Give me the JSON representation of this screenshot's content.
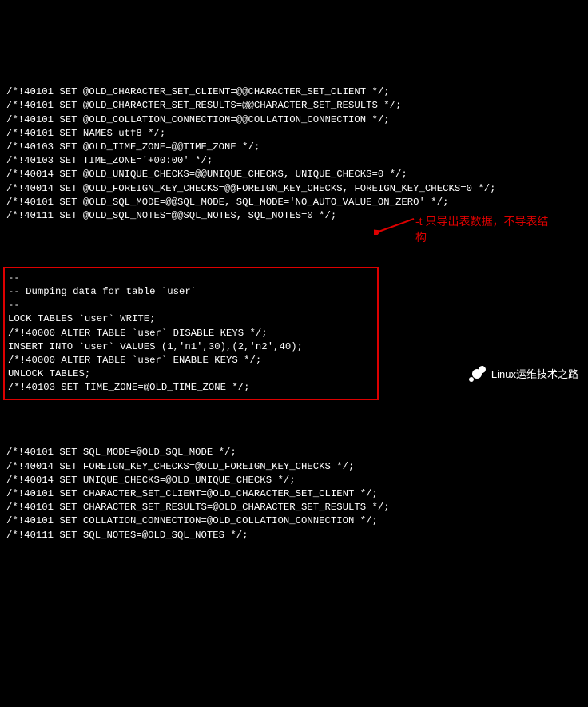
{
  "header_lines": [
    "/*!40101 SET @OLD_CHARACTER_SET_CLIENT=@@CHARACTER_SET_CLIENT */;",
    "/*!40101 SET @OLD_CHARACTER_SET_RESULTS=@@CHARACTER_SET_RESULTS */;",
    "/*!40101 SET @OLD_COLLATION_CONNECTION=@@COLLATION_CONNECTION */;",
    "/*!40101 SET NAMES utf8 */;",
    "/*!40103 SET @OLD_TIME_ZONE=@@TIME_ZONE */;",
    "/*!40103 SET TIME_ZONE='+00:00' */;",
    "/*!40014 SET @OLD_UNIQUE_CHECKS=@@UNIQUE_CHECKS, UNIQUE_CHECKS=0 */;",
    "/*!40014 SET @OLD_FOREIGN_KEY_CHECKS=@@FOREIGN_KEY_CHECKS, FOREIGN_KEY_CHECKS=0 */;",
    "/*!40101 SET @OLD_SQL_MODE=@@SQL_MODE, SQL_MODE='NO_AUTO_VALUE_ON_ZERO' */;",
    "/*!40111 SET @OLD_SQL_NOTES=@@SQL_NOTES, SQL_NOTES=0 */;"
  ],
  "boxed_block": [
    "--",
    "-- Dumping data for table `user`",
    "--",
    "",
    "LOCK TABLES `user` WRITE;",
    "/*!40000 ALTER TABLE `user` DISABLE KEYS */;",
    "INSERT INTO `user` VALUES (1,'n1',30),(2,'n2',40);",
    "/*!40000 ALTER TABLE `user` ENABLE KEYS */;",
    "UNLOCK TABLES;",
    "/*!40103 SET TIME_ZONE=@OLD_TIME_ZONE */;"
  ],
  "footer_lines": [
    "/*!40101 SET SQL_MODE=@OLD_SQL_MODE */;",
    "/*!40014 SET FOREIGN_KEY_CHECKS=@OLD_FOREIGN_KEY_CHECKS */;",
    "/*!40014 SET UNIQUE_CHECKS=@OLD_UNIQUE_CHECKS */;",
    "/*!40101 SET CHARACTER_SET_CLIENT=@OLD_CHARACTER_SET_CLIENT */;",
    "/*!40101 SET CHARACTER_SET_RESULTS=@OLD_CHARACTER_SET_RESULTS */;",
    "/*!40101 SET COLLATION_CONNECTION=@OLD_COLLATION_CONNECTION */;",
    "/*!40111 SET SQL_NOTES=@OLD_SQL_NOTES */;"
  ],
  "annotation": {
    "line1": "-t 只导出表数据，不导表结",
    "line2": "构"
  },
  "watermark_text": "Linux运维技术之路",
  "colors": {
    "bg": "#000000",
    "text": "#ffffff",
    "accent": "#d00000"
  }
}
